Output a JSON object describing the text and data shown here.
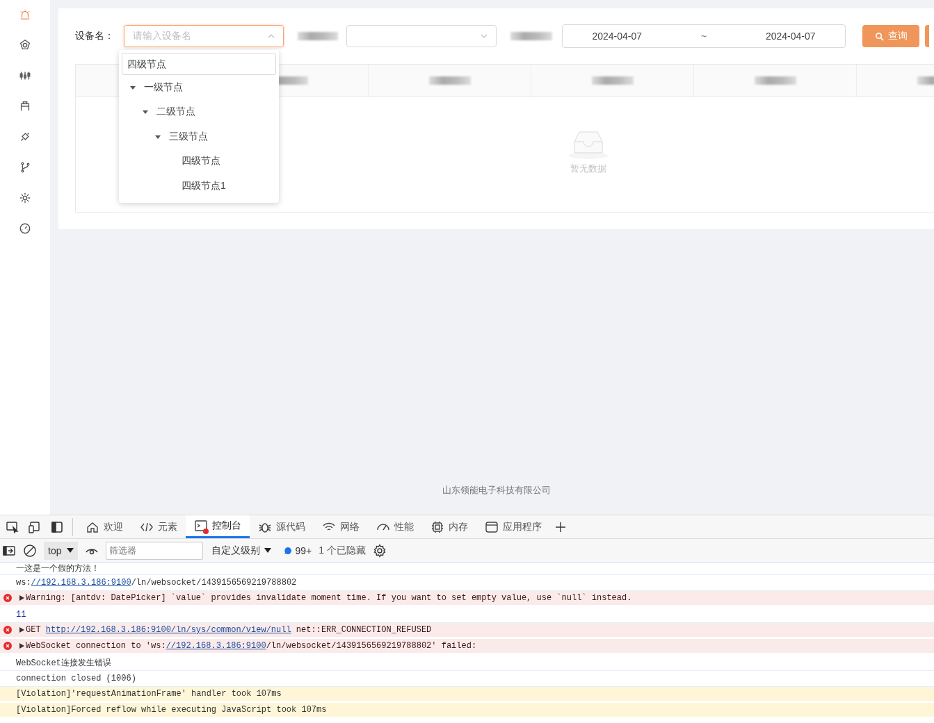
{
  "sidebar": {
    "items": [
      {
        "selected": true
      },
      {
        "selected": false
      },
      {
        "selected": false
      },
      {
        "selected": false
      },
      {
        "selected": false
      },
      {
        "selected": false
      },
      {
        "selected": false
      },
      {
        "selected": false
      }
    ]
  },
  "filters": {
    "device_label": "设备名：",
    "device_select": {
      "placeholder": "请输入设备名",
      "open": true
    },
    "date_from": "2024-04-07",
    "date_sep": "~",
    "date_to": "2024-04-07",
    "query_button": "查询"
  },
  "dropdown": {
    "search_value": "四级节点",
    "tree": [
      {
        "label": "一级节点",
        "expanded": true,
        "children": [
          {
            "label": "二级节点",
            "expanded": true,
            "children": [
              {
                "label": "三级节点",
                "expanded": true,
                "children": [
                  {
                    "label": "四级节点"
                  },
                  {
                    "label": "四级节点1"
                  }
                ]
              }
            ]
          }
        ]
      }
    ]
  },
  "table": {
    "empty_text": "暂无数据"
  },
  "footer": "山东领能电子科技有限公司",
  "devtools": {
    "tabs": [
      {
        "label": "欢迎",
        "selected": false
      },
      {
        "label": "元素",
        "selected": false
      },
      {
        "label": "控制台",
        "selected": true
      },
      {
        "label": "源代码",
        "selected": false
      },
      {
        "label": "网络",
        "selected": false
      },
      {
        "label": "性能",
        "selected": false
      },
      {
        "label": "内存",
        "selected": false
      },
      {
        "label": "应用程序",
        "selected": false
      }
    ],
    "context": "top",
    "filter_placeholder": "筛选器",
    "level": "自定义级别",
    "message_count": "99+",
    "hidden": "1 个已隐藏",
    "messages": [
      {
        "kind": "log",
        "parts": [
          {
            "text": "一这是一个假的方法！"
          }
        ]
      },
      {
        "kind": "log",
        "parts": [
          {
            "kind": "text",
            "text": "ws:"
          },
          {
            "kind": "link",
            "text": "//192.168.3.186:9100"
          },
          {
            "kind": "text",
            "text": "/ln/websocket/1439156569219788802"
          }
        ]
      },
      {
        "kind": "error",
        "parts": [
          {
            "text": "Warning: [antdv: DatePicker] `value` provides invalidate moment time. If you want to set empty value, use `null` instead."
          }
        ]
      },
      {
        "kind": "value",
        "parts": [
          {
            "text": "11"
          }
        ]
      },
      {
        "kind": "error",
        "parts": [
          {
            "kind": "text",
            "text": "GET "
          },
          {
            "kind": "link",
            "text": "http://192.168.3.186:9100/ln/sys/common/view/null"
          },
          {
            "kind": "text",
            "text": " net::ERR_CONNECTION_REFUSED"
          }
        ]
      },
      {
        "kind": "error",
        "parts": [
          {
            "kind": "text",
            "text": "WebSocket connection to 'ws:"
          },
          {
            "kind": "link",
            "text": "//192.168.3.186:9100"
          },
          {
            "kind": "text",
            "text": "/ln/websocket/1439156569219788802' failed:"
          }
        ]
      },
      {
        "kind": "log",
        "parts": [
          {
            "text": "WebSocket连接发生错误"
          }
        ]
      },
      {
        "kind": "log",
        "parts": [
          {
            "text": "connection closed (1006)"
          }
        ]
      },
      {
        "kind": "violation",
        "parts": [
          {
            "text": "[Violation]'requestAnimationFrame' handler took 107ms"
          }
        ]
      },
      {
        "kind": "violation",
        "parts": [
          {
            "text": "[Violation]Forced reflow while executing JavaScript took 107ms"
          }
        ]
      }
    ]
  }
}
